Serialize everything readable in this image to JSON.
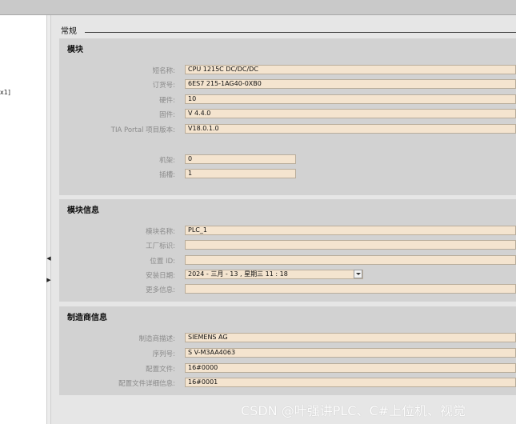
{
  "tree": {
    "fragment": "x1]"
  },
  "general": {
    "title": "常规"
  },
  "module": {
    "title": "模块",
    "short_name": {
      "label": "短名称:",
      "value": "CPU 1215C DC/DC/DC"
    },
    "order_number": {
      "label": "订货号:",
      "value": "6ES7 215-1AG40-0XB0"
    },
    "hardware": {
      "label": "硬件:",
      "value": "10"
    },
    "firmware": {
      "label": "固件:",
      "value": "V 4.4.0"
    },
    "tia_version": {
      "label": "TIA Portal 项目版本:",
      "value": "V18.0.1.0"
    },
    "rack": {
      "label": "机架:",
      "value": "0"
    },
    "slot": {
      "label": "插槽:",
      "value": "1"
    }
  },
  "module_info": {
    "title": "模块信息",
    "module_name": {
      "label": "模块名称:",
      "value": "PLC_1"
    },
    "plant_id": {
      "label": "工厂标识:",
      "value": ""
    },
    "location_id": {
      "label": "位置 ID:",
      "value": ""
    },
    "install_date": {
      "label": "安装日期:",
      "value": "2024 - 三月  - 13 , 星期三   11 : 18"
    },
    "more_info": {
      "label": "更多信息:",
      "value": ""
    }
  },
  "manufacturer": {
    "title": "制造商信息",
    "description": {
      "label": "制造商描述:",
      "value": "SIEMENS AG"
    },
    "serial": {
      "label": "序列号:",
      "value": "S V-M3AA4063"
    },
    "config_file": {
      "label": "配置文件:",
      "value": "16#0000"
    },
    "config_detail": {
      "label": "配置文件详细信息:",
      "value": "16#0001"
    }
  },
  "watermark": "CSDN @叶强讲PLC、C#上位机、视觉",
  "icons": {
    "combo": "chevron-down-icon",
    "collapse": "arrow-left-icon",
    "expand": "arrow-right-icon"
  }
}
